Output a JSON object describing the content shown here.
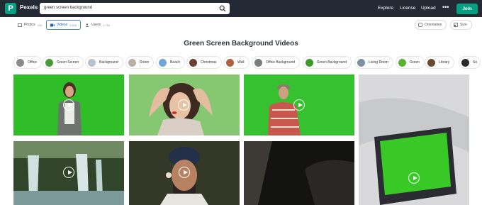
{
  "header": {
    "logo_letter": "P",
    "brand": "Pexels",
    "search_value": "green screen background",
    "nav": [
      "Explore",
      "License",
      "Upload"
    ],
    "more": "•••",
    "join": "Join"
  },
  "tabs": [
    {
      "label": "Photos",
      "count": "10K",
      "icon": "photo-icon",
      "active": false
    },
    {
      "label": "Videos",
      "count": "2,816",
      "icon": "video-icon",
      "active": true
    },
    {
      "label": "Users",
      "count": "1,766",
      "icon": "users-icon",
      "active": false
    }
  ],
  "filters": {
    "orientation": "Orientation",
    "size": "Size"
  },
  "heading": "Green Screen Background Videos",
  "chips": [
    "Office",
    "Green Screen",
    "Background",
    "Room",
    "Beach",
    "Christmas",
    "Wall",
    "Office Background",
    "Green Background",
    "Living Room",
    "Green",
    "Library",
    "Sn"
  ],
  "colors": {
    "accent": "#05a081",
    "topbar": "#232a34",
    "active_tab": "#4a7fd4"
  }
}
